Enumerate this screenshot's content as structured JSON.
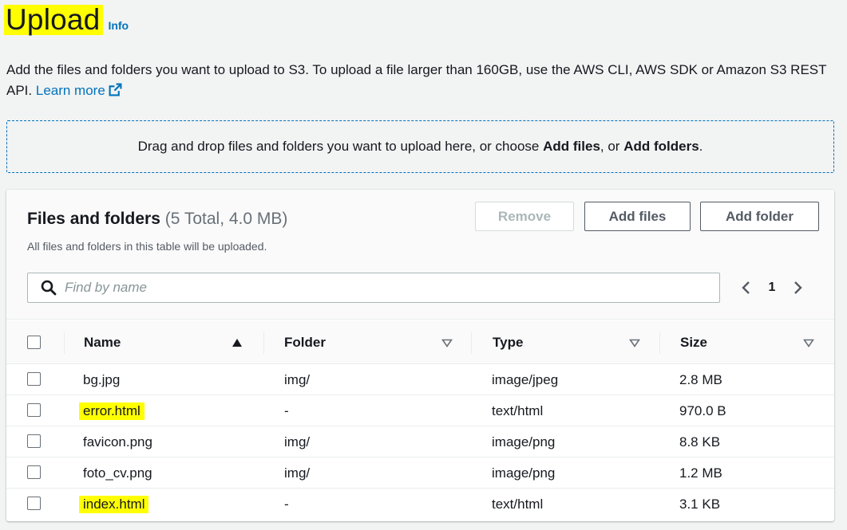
{
  "header": {
    "title": "Upload",
    "info_label": "Info"
  },
  "description": {
    "text": "Add the files and folders you want to upload to S3. To upload a file larger than 160GB, use the AWS CLI, AWS SDK or Amazon S3 REST API.",
    "learn_more": "Learn more",
    "icon": "external-link-icon"
  },
  "dropzone": {
    "prefix": "Drag and drop files and folders you want to upload here, or choose ",
    "add_files": "Add files",
    "separator": ", or ",
    "add_folders": "Add folders",
    "suffix": "."
  },
  "panel": {
    "title": "Files and folders",
    "count": "(5 Total, 4.0 MB)",
    "subtitle": "All files and folders in this table will be uploaded.",
    "buttons": {
      "remove": "Remove",
      "add_files": "Add files",
      "add_folder": "Add folder"
    },
    "search": {
      "placeholder": "Find by name",
      "value": ""
    },
    "pagination": {
      "current_page": "1"
    }
  },
  "table": {
    "columns": [
      {
        "label": "Name",
        "sort": "ascending"
      },
      {
        "label": "Folder",
        "sort": "none"
      },
      {
        "label": "Type",
        "sort": "none"
      },
      {
        "label": "Size",
        "sort": "none"
      }
    ],
    "rows": [
      {
        "name": "bg.jpg",
        "folder": "img/",
        "type": "image/jpeg",
        "size": "2.8 MB",
        "highlighted": false
      },
      {
        "name": "error.html",
        "folder": "-",
        "type": "text/html",
        "size": "970.0 B",
        "highlighted": true
      },
      {
        "name": "favicon.png",
        "folder": "img/",
        "type": "image/png",
        "size": "8.8 KB",
        "highlighted": false
      },
      {
        "name": "foto_cv.png",
        "folder": "img/",
        "type": "image/png",
        "size": "1.2 MB",
        "highlighted": false
      },
      {
        "name": "index.html",
        "folder": "-",
        "type": "text/html",
        "size": "3.1 KB",
        "highlighted": true
      }
    ]
  },
  "colors": {
    "link": "#0073bb",
    "highlight": "#ffff00",
    "background": "#f2f3f3"
  }
}
